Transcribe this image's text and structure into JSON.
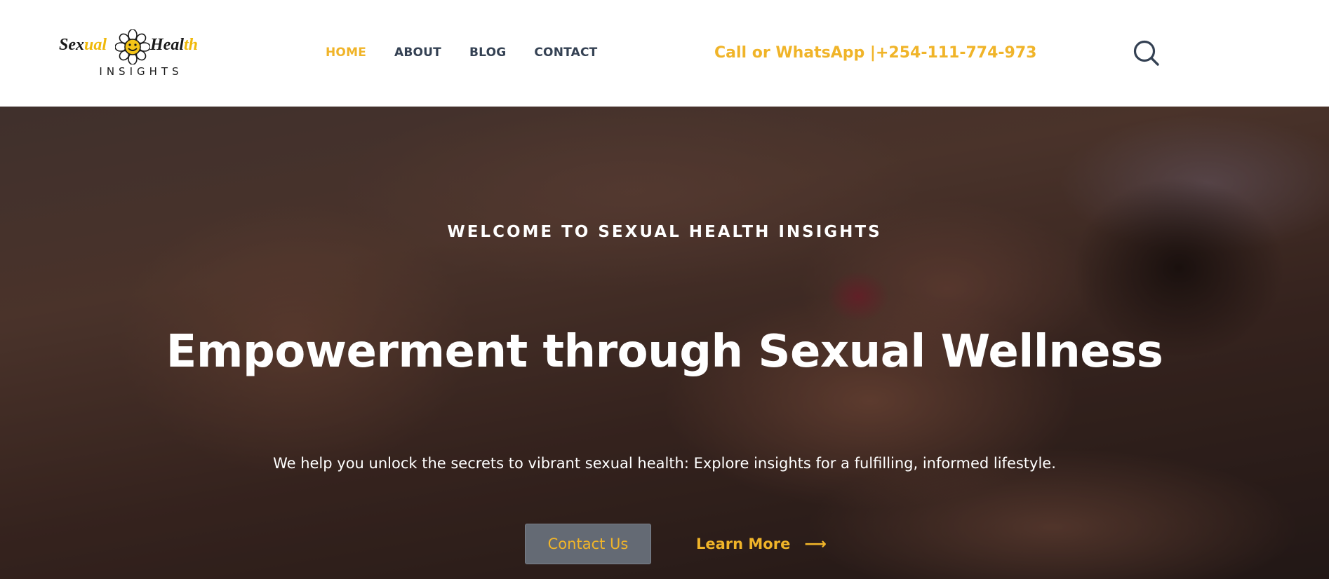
{
  "header": {
    "logo": {
      "word1_part1": "Sex",
      "word1_part2": "ual",
      "word2_part1": "Heal",
      "word2_part2": "th",
      "subtitle": "INSIGHTS",
      "icon": "smiley-flower-icon"
    },
    "nav": [
      {
        "label": "HOME",
        "active": true
      },
      {
        "label": "ABOUT",
        "active": false
      },
      {
        "label": "BLOG",
        "active": false
      },
      {
        "label": "CONTACT",
        "active": false
      }
    ],
    "phone_text": "Call or WhatsApp |+254-111-774-973",
    "search_icon": "search-icon"
  },
  "hero": {
    "eyebrow": "WELCOME TO SEXUAL HEALTH INSIGHTS",
    "headline": "Empowerment through Sexual Wellness",
    "subtext": "We help you unlock the secrets to vibrant sexual health: Explore insights for a fulfilling, informed lifestyle.",
    "primary_cta": "Contact Us",
    "secondary_cta": "Learn More",
    "secondary_cta_icon": "arrow-right-icon"
  },
  "colors": {
    "accent": "#f0b429",
    "nav_text": "#344153",
    "button_bg": "#646a74"
  }
}
